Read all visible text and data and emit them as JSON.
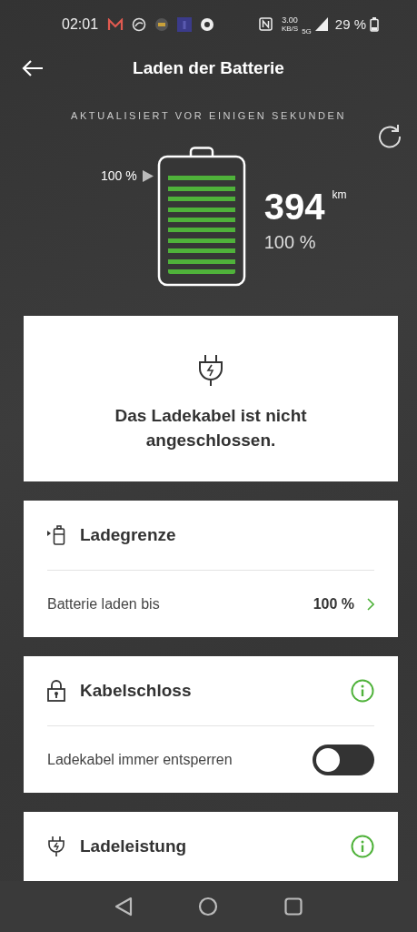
{
  "status_bar": {
    "time": "02:01",
    "speed": "3.00",
    "speed_unit": "KB/S",
    "network": "5G",
    "battery": "29 %"
  },
  "header": {
    "title": "Laden der Batterie"
  },
  "updated": "AKTUALISIERT VOR EINIGEN SEKUNDEN",
  "battery": {
    "limit_label": "100 %",
    "range": "394",
    "range_unit": "km",
    "percent": "100 %"
  },
  "cable_card": {
    "message": "Das Ladekabel ist nicht angeschlossen."
  },
  "sections": [
    {
      "kind": "limit",
      "title": "Ladegrenze",
      "info": false,
      "row": {
        "label": "Batterie laden bis",
        "value": "100 %"
      }
    },
    {
      "kind": "lock",
      "title": "Kabelschloss",
      "info": true,
      "row": {
        "label": "Ladekabel immer entsperren",
        "on": false
      }
    },
    {
      "kind": "power",
      "title": "Ladeleistung",
      "info": true
    }
  ]
}
